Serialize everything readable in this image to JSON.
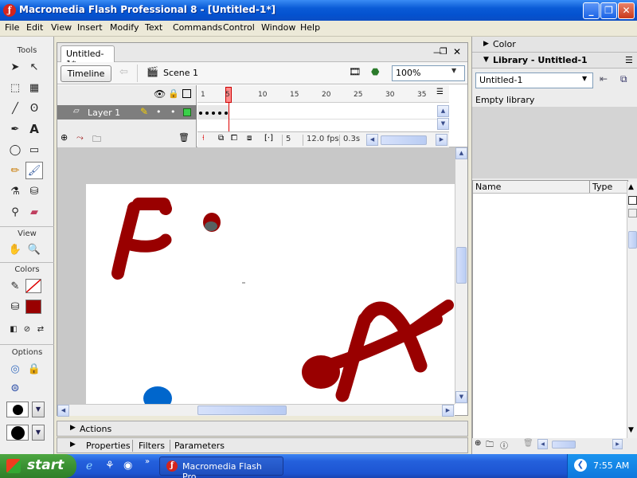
{
  "window": {
    "title": "Macromedia Flash Professional 8 - [Untitled-1*]",
    "app_icon": "flash-app-icon"
  },
  "menu": [
    "File",
    "Edit",
    "View",
    "Insert",
    "Modify",
    "Text",
    "Commands",
    "Control",
    "Window",
    "Help"
  ],
  "tools_panel": {
    "tools_label": "Tools",
    "view_label": "View",
    "colors_label": "Colors",
    "options_label": "Options",
    "selected_tool": "brush-tool",
    "stroke_color": "#ffffff",
    "fill_color": "#990000"
  },
  "document": {
    "tab_label": "Untitled-1*",
    "timeline_button": "Timeline",
    "scene_label": "Scene 1",
    "zoom": "100%"
  },
  "timeline": {
    "layer_name": "Layer 1",
    "ruler_numbers": [
      "1",
      "5",
      "10",
      "15",
      "20",
      "25",
      "30",
      "35"
    ],
    "current_frame": "5",
    "frame_rate": "12.0 fps",
    "elapsed_time": "0.3s",
    "keyframes_count": 5
  },
  "stage": {
    "background": "#ffffff",
    "brush_color": "#990000",
    "blue_dot_color": "#0066cc"
  },
  "bottom_panels": {
    "actions_label": "Actions",
    "properties_label": "Properties",
    "filters_label": "Filters",
    "parameters_label": "Parameters"
  },
  "right_panels": {
    "color_label": "Color",
    "library_label": "Library - Untitled-1",
    "library_select": "Untitled-1",
    "empty_library": "Empty library",
    "col_name": "Name",
    "col_type": "Type"
  },
  "taskbar": {
    "start_label": "start",
    "task_label": "Macromedia Flash Pro...",
    "clock": "7:55 AM"
  }
}
